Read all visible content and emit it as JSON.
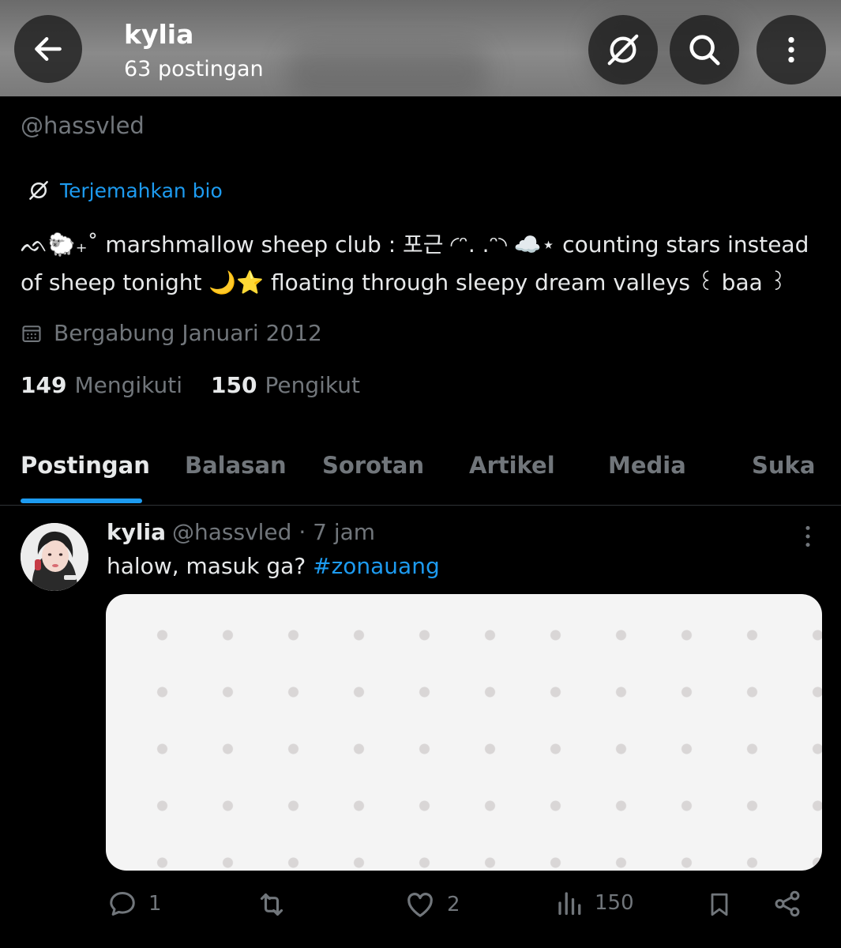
{
  "header": {
    "title": "kylia",
    "subtitle": "63 postingan"
  },
  "profile": {
    "handle": "@hassvled",
    "translate_label": "Terjemahkan bio",
    "bio": "ᨒ🐑₊˚ marshmallow sheep club : 포근 ◜ᵔ. .ᵔ◝ ☁️⋆ counting stars instead of sheep tonight 🌙⭐ floating through sleepy dream valleys ꒰ baa ꒱",
    "joined": "Bergabung Januari 2012",
    "following_count": "149",
    "following_label": "Mengikuti",
    "followers_count": "150",
    "followers_label": "Pengikut"
  },
  "tabs": [
    {
      "label": "Postingan",
      "active": true
    },
    {
      "label": "Balasan",
      "active": false
    },
    {
      "label": "Sorotan",
      "active": false
    },
    {
      "label": "Artikel",
      "active": false
    },
    {
      "label": "Media",
      "active": false
    },
    {
      "label": "Suka",
      "active": false
    }
  ],
  "post": {
    "name": "kylia",
    "handle": "@hassvled",
    "separator": "·",
    "time": "7 jam",
    "text": "halow, masuk ga?",
    "hashtag": "#zonauang",
    "replies": "1",
    "reposts": "",
    "likes": "2",
    "views": "150"
  },
  "colors": {
    "accent": "#1d9bf0",
    "background": "#000000",
    "muted": "#71767b",
    "text": "#e7e9ea"
  },
  "icons": [
    "back-arrow-icon",
    "translate-icon",
    "search-icon",
    "more-vertical-icon",
    "calendar-icon",
    "reply-icon",
    "repost-icon",
    "like-icon",
    "views-icon",
    "bookmark-icon",
    "share-icon"
  ]
}
